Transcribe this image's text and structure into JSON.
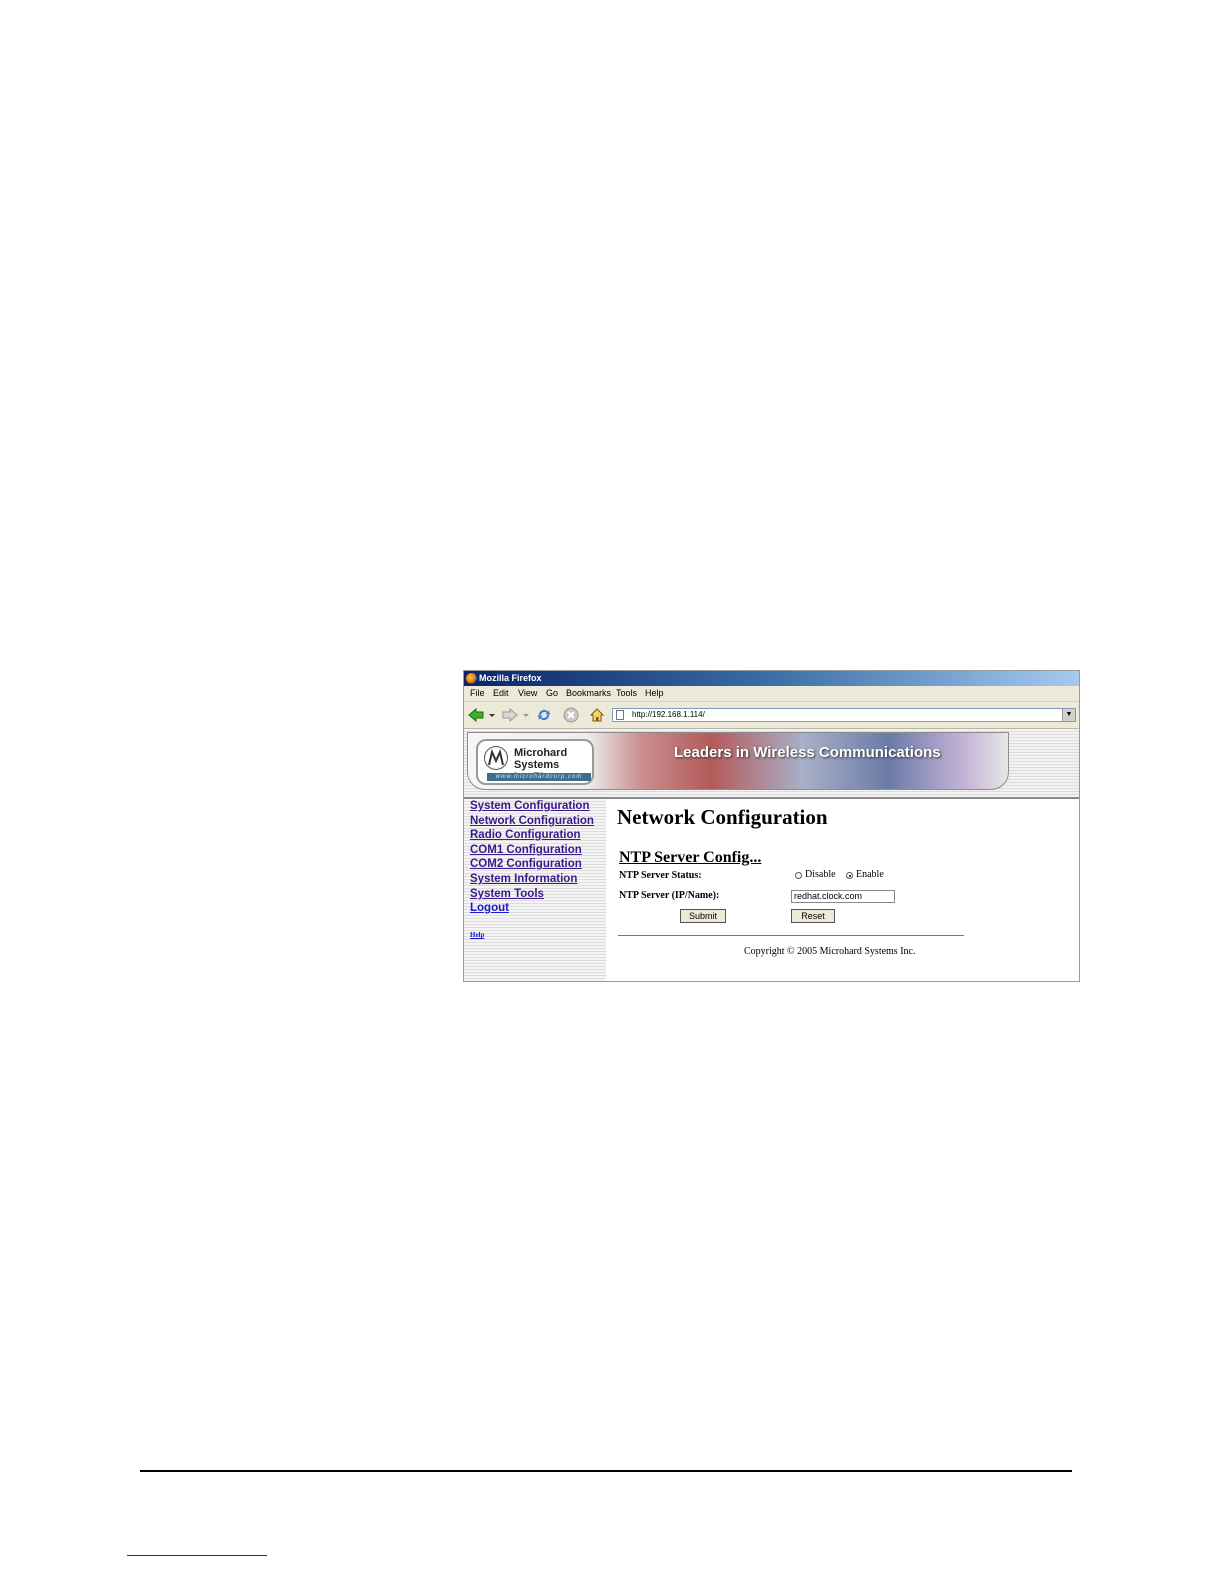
{
  "browser": {
    "title": "Mozilla Firefox",
    "menu": [
      "File",
      "Edit",
      "View",
      "Go",
      "Bookmarks",
      "Tools",
      "Help"
    ],
    "url": "http://192.168.1.114/"
  },
  "banner": {
    "logo_line1": "Microhard",
    "logo_line2": "Systems Inc.™",
    "logo_url": "www.microhardcorp.com",
    "tagline": "Leaders in Wireless Communications"
  },
  "nav": {
    "items": [
      "System Configuration",
      "Network Configuration",
      "Radio Configuration",
      "COM1 Configuration",
      "COM2 Configuration",
      "System Information",
      "System Tools",
      "Logout"
    ],
    "help": "Help"
  },
  "main": {
    "title": "Network Configuration",
    "section": "NTP Server Config...",
    "status_label": "NTP Server Status:",
    "disable_label": "Disable",
    "enable_label": "Enable",
    "selected_status": "Enable",
    "server_label": "NTP Server (IP/Name):",
    "server_value": "redhat.clock.com",
    "submit_label": "Submit",
    "reset_label": "Reset",
    "copyright": "Copyright © 2005 Microhard Systems Inc."
  }
}
